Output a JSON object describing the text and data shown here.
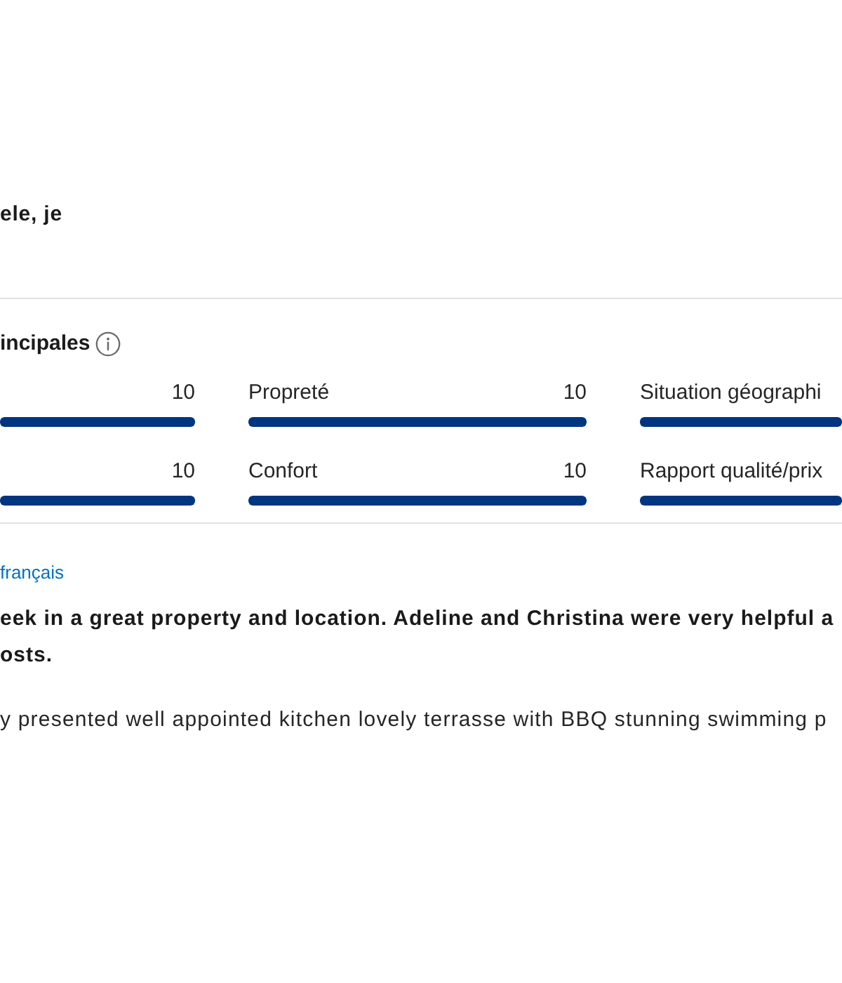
{
  "header_text": "ele, je",
  "ratings": {
    "title": "incipales",
    "categories": [
      {
        "score": "10",
        "level": 1
      },
      {
        "label": "Propreté",
        "score": "10",
        "level": 1
      },
      {
        "label": "Situation géographi",
        "level": 1
      },
      {
        "score": "10",
        "level": 1
      },
      {
        "label": "Confort",
        "score": "10",
        "level": 1
      },
      {
        "label": "Rapport qualité/prix",
        "level": 1
      }
    ]
  },
  "review": {
    "language_link": "français",
    "title_lines": [
      "eek in a great property and location. Adeline and Christina were very helpful a",
      "osts."
    ],
    "text": "y presented well appointed kitchen lovely terrasse with BBQ stunning swimming p"
  }
}
